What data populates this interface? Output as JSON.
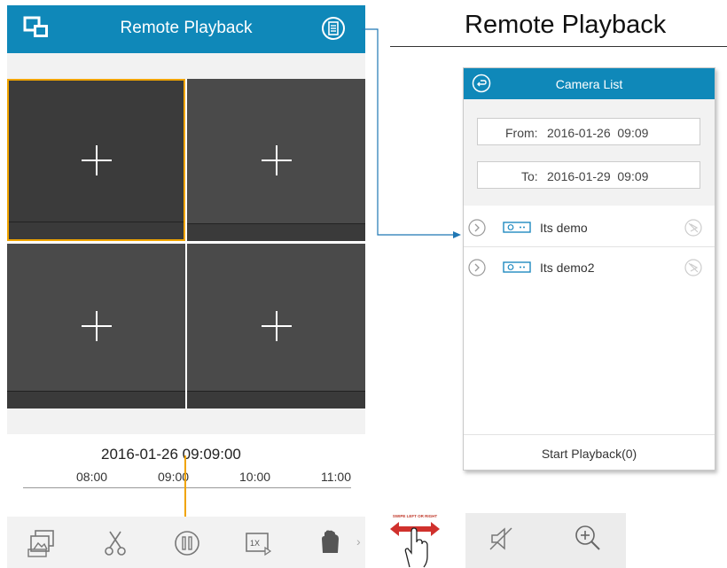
{
  "phone": {
    "title": "Remote Playback",
    "header_color": "#0f88b9",
    "icons": {
      "multi_window": "multi-window-icon",
      "camera_list": "list-icon"
    },
    "channels": [
      {
        "selected": true,
        "icon": "plus-icon"
      },
      {
        "selected": false,
        "icon": "plus-icon"
      },
      {
        "selected": false,
        "icon": "plus-icon"
      },
      {
        "selected": false,
        "icon": "plus-icon"
      }
    ],
    "timeline": {
      "current": "2016-01-26 09:09:00",
      "ticks": [
        "08:00",
        "09:00",
        "10:00",
        "11:00"
      ],
      "playhead_color": "#f0a400"
    },
    "toolbar": [
      "capture-icon",
      "clip-icon",
      "pause-icon",
      "speed-1x-icon",
      "stop-icon",
      "chevron-right-icon"
    ]
  },
  "annotation": {
    "title": "Remote Playback"
  },
  "camera_list": {
    "title": "Camera List",
    "from_label": "From:",
    "from_value": "2016-01-26  09:09",
    "to_label": "To:",
    "to_value": "2016-01-29  09:09",
    "cameras": [
      {
        "name": "Its demo"
      },
      {
        "name": "Its demo2"
      }
    ],
    "start_button": "Start Playback(0)"
  },
  "gesture": {
    "label": "SWIPE LEFT OR RIGHT",
    "icon": "swipe-hand-icon"
  },
  "extra_toolbar": [
    "mute-icon",
    "zoom-in-icon"
  ]
}
